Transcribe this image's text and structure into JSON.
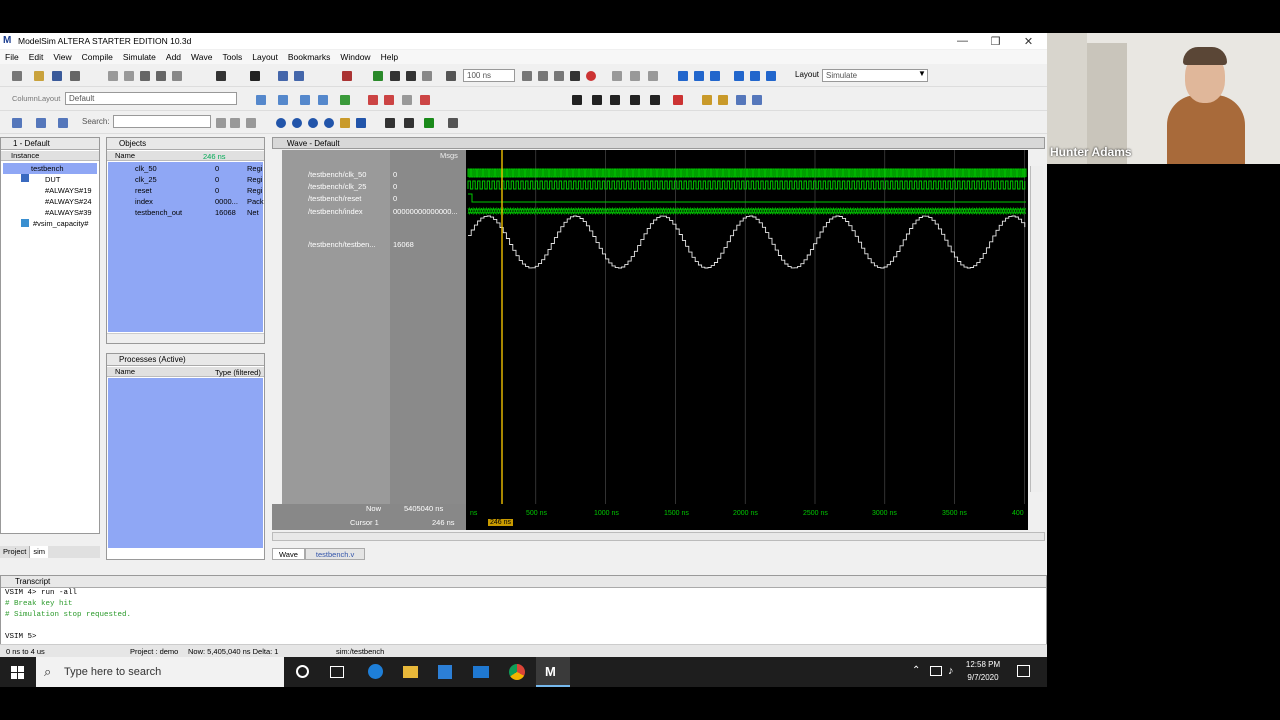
{
  "window": {
    "title": "ModelSim ALTERA STARTER EDITION 10.3d",
    "min": "—",
    "max": "❒",
    "close": "✕"
  },
  "menu": [
    "File",
    "Edit",
    "View",
    "Compile",
    "Simulate",
    "Add",
    "Wave",
    "Tools",
    "Layout",
    "Bookmarks",
    "Window",
    "Help"
  ],
  "toolbar": {
    "run_length": "100 ns",
    "layout_label": "Layout",
    "layout_value": "Simulate",
    "column_layout_label": "ColumnLayout",
    "column_layout_value": "Default",
    "search_label": "Search:"
  },
  "instance_panel": {
    "title": "1 - Default",
    "col": "Instance",
    "items": [
      "testbench",
      "DUT",
      "#ALWAYS#19",
      "#ALWAYS#24",
      "#ALWAYS#39",
      "#vsim_capacity#"
    ]
  },
  "objects_panel": {
    "title": "Objects",
    "col_name": "Name",
    "col_time": "246 ns",
    "rows": [
      {
        "name": "clk_50",
        "value": "0",
        "kind": "Regi"
      },
      {
        "name": "clk_25",
        "value": "0",
        "kind": "Regi"
      },
      {
        "name": "reset",
        "value": "0",
        "kind": "Regi"
      },
      {
        "name": "index",
        "value": "0000...",
        "kind": "Pack"
      },
      {
        "name": "testbench_out",
        "value": "16068",
        "kind": "Net"
      }
    ]
  },
  "processes_panel": {
    "title": "Processes (Active)",
    "col_name": "Name",
    "col_type": "Type (filtered)"
  },
  "bottom_tabs_left": [
    "Project",
    "sim"
  ],
  "wave": {
    "title": "Wave - Default",
    "msgs": "Msgs",
    "signals": [
      {
        "name": "/testbench/clk_50",
        "value": "0"
      },
      {
        "name": "/testbench/clk_25",
        "value": "0"
      },
      {
        "name": "/testbench/reset",
        "value": "0"
      },
      {
        "name": "/testbench/index",
        "value": "00000000000000..."
      },
      {
        "name": "/testbench/testben...",
        "value": "16068"
      }
    ],
    "now_label": "Now",
    "now_value": "5405040 ns",
    "cursor_label": "Cursor 1",
    "cursor_value": "246 ns",
    "cursor_flag": "246 ns",
    "ticks": [
      "ns",
      "500 ns",
      "1000 ns",
      "1500 ns",
      "2000 ns",
      "2500 ns",
      "3000 ns",
      "3500 ns",
      "400"
    ],
    "tabs": [
      "Wave",
      "testbench.v"
    ]
  },
  "transcript": {
    "title": "Transcript",
    "lines": [
      "VSIM 4> run -all",
      "# Break key hit",
      "# Simulation stop requested.",
      "",
      "VSIM 5>"
    ]
  },
  "status": {
    "range": "0 ns to 4 us",
    "project": "Project : demo",
    "now": "Now: 5,405,040 ns  Delta: 1",
    "context": "sim:/testbench"
  },
  "taskbar": {
    "search_placeholder": "Type here to search",
    "time": "12:58 PM",
    "date": "9/7/2020"
  },
  "webcam": {
    "name": "Hunter Adams"
  },
  "colors": {
    "wave_green": "#00c800",
    "cursor_yellow": "#f0c000",
    "select_blue": "#8fa7f5"
  }
}
